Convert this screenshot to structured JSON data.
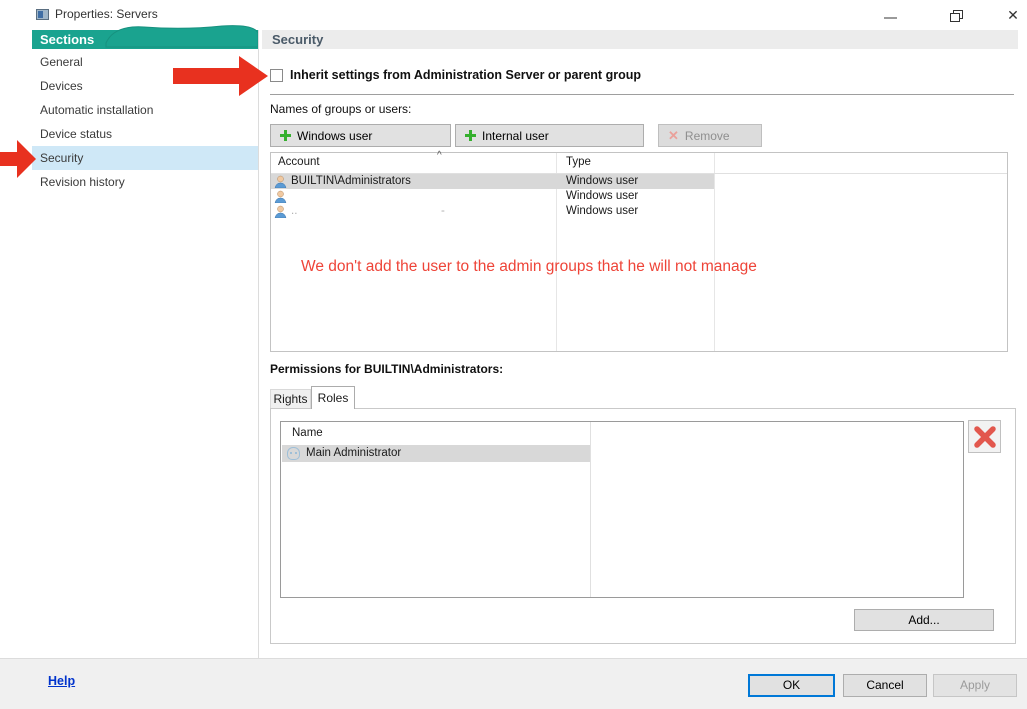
{
  "window": {
    "title": "Properties: Servers",
    "controls": {
      "minimize": "minimize",
      "restore": "restore",
      "close": "✕"
    }
  },
  "sidebar": {
    "header": "Sections",
    "items": [
      {
        "label": "General",
        "selected": false
      },
      {
        "label": "Devices",
        "selected": false
      },
      {
        "label": "Automatic installation",
        "selected": false
      },
      {
        "label": "Device status",
        "selected": false
      },
      {
        "label": "Security",
        "selected": true
      },
      {
        "label": "Revision history",
        "selected": false
      }
    ]
  },
  "main": {
    "header": "Security",
    "inherit_checkbox": {
      "label": "Inherit settings from Administration Server or parent group",
      "checked": false
    },
    "names_label": "Names of groups or users:",
    "buttons": {
      "windows_user": "Windows user",
      "internal_user": "Internal user",
      "remove": "Remove",
      "remove_enabled": false
    },
    "accounts_table": {
      "columns": [
        "Account",
        "Type"
      ],
      "sort_caret": "^",
      "rows": [
        {
          "account": "BUILTIN\\Administrators",
          "type": "Windows user",
          "selected": true
        },
        {
          "account": "",
          "type": "Windows user",
          "selected": false
        },
        {
          "account": "..",
          "type": "Windows user",
          "selected": false,
          "remnant": "-"
        }
      ]
    },
    "annotation": "We don't add the user to the admin groups that he will not manage",
    "permissions_label": "Permissions for BUILTIN\\Administrators:",
    "tabs": [
      {
        "label": "Rights",
        "active": false
      },
      {
        "label": "Roles",
        "active": true
      }
    ],
    "roles_table": {
      "columns": [
        "Name"
      ],
      "rows": [
        {
          "name": "Main Administrator",
          "selected": true
        }
      ]
    },
    "add_button": "Add..."
  },
  "footer": {
    "help": "Help",
    "ok": "OK",
    "cancel": "Cancel",
    "apply": "Apply",
    "apply_enabled": false
  },
  "colors": {
    "teal": "#1aa38f",
    "sidebar_selection": "#cfe8f7",
    "annotation_red": "#ee4438",
    "arrow_red": "#e8311f",
    "link_blue": "#0033cc",
    "focus_blue": "#0078d7",
    "plus_green": "#35b02e",
    "delete_x_red": "#e2574d"
  }
}
